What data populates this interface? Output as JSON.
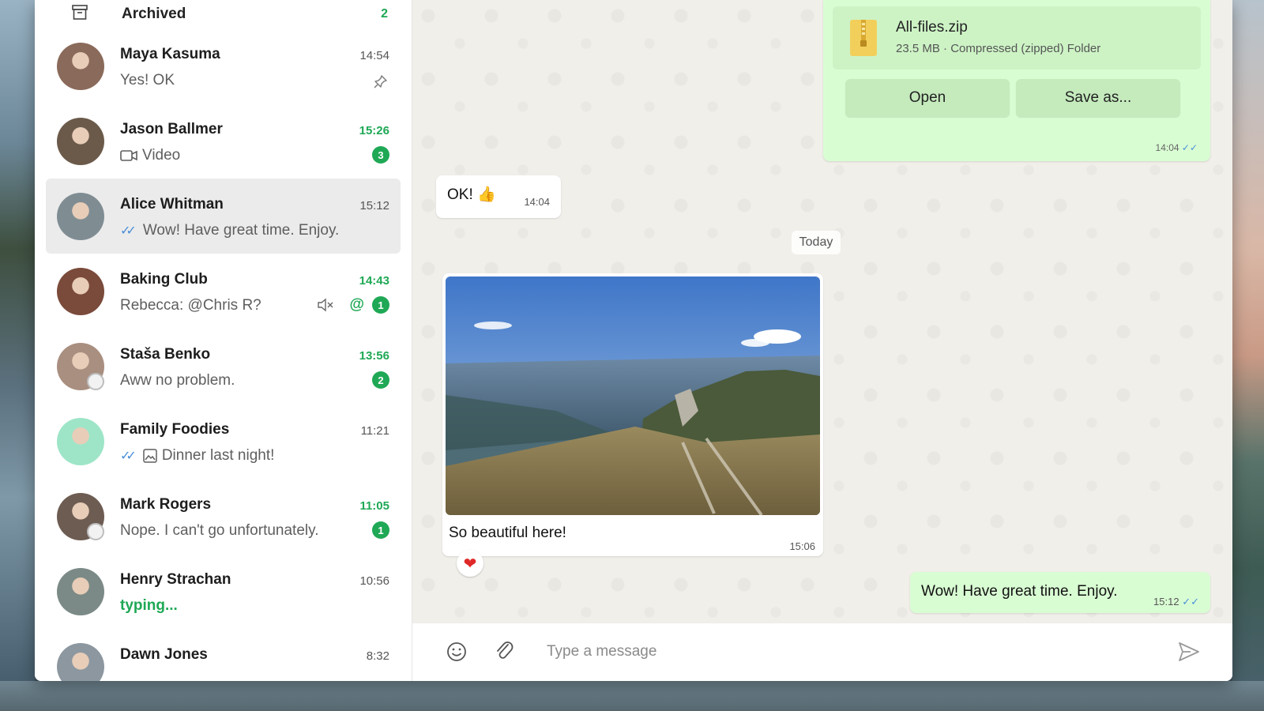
{
  "sidebar": {
    "archived": {
      "label": "Archived",
      "count": "2"
    },
    "chats": [
      {
        "name": "Maya Kasuma",
        "time": "14:54",
        "preview": "Yes! OK",
        "pinned": true,
        "unread": false,
        "avatar_color": "#8a6a5a"
      },
      {
        "name": "Jason Ballmer",
        "time": "15:26",
        "preview": "Video",
        "badge": "3",
        "unread": true,
        "avatar_color": "#6b5a4a"
      },
      {
        "name": "Alice Whitman",
        "time": "15:12",
        "preview": "Wow! Have great time. Enjoy.",
        "read_ticks": true,
        "selected": true,
        "avatar_color": "#7f8d93"
      },
      {
        "name": "Baking Club",
        "time": "14:43",
        "preview": "Rebecca: @Chris R?",
        "muted": true,
        "mention": true,
        "badge": "1",
        "unread": true,
        "avatar_color": "#7a4a3a"
      },
      {
        "name": "Staša Benko",
        "time": "13:56",
        "preview": "Aww no problem.",
        "badge": "2",
        "unread": true,
        "avatar_color": "#a98f80"
      },
      {
        "name": "Family Foodies",
        "time": "11:21",
        "preview": "Dinner last night!",
        "read_ticks": true,
        "image_icon": true,
        "avatar_color": "#9ee5c8"
      },
      {
        "name": "Mark Rogers",
        "time": "11:05",
        "preview": "Nope. I can't go unfortunately.",
        "badge": "1",
        "unread": true,
        "avatar_color": "#6d5c52"
      },
      {
        "name": "Henry Strachan",
        "time": "10:56",
        "preview": "typing...",
        "typing": true,
        "avatar_color": "#7b8a86"
      },
      {
        "name": "Dawn Jones",
        "time": "8:32",
        "preview": "",
        "avatar_color": "#8c97a0"
      }
    ]
  },
  "conversation": {
    "file": {
      "name": "All-files.zip",
      "meta": "23.5 MB · Compressed (zipped) Folder",
      "open_label": "Open",
      "save_label": "Save as...",
      "time": "14:04"
    },
    "ok_message": {
      "text": "OK! 👍",
      "time": "14:04"
    },
    "date_chip": "Today",
    "photo_message": {
      "caption": "So beautiful here!",
      "time": "15:06",
      "reaction": "❤"
    },
    "out_message": {
      "text": "Wow! Have great time. Enjoy.",
      "time": "15:12"
    }
  },
  "composer": {
    "placeholder": "Type a message"
  },
  "colors": {
    "accent": "#1fa855",
    "outgoing": "#d9fdd3",
    "tick_blue": "#4a90d9"
  }
}
